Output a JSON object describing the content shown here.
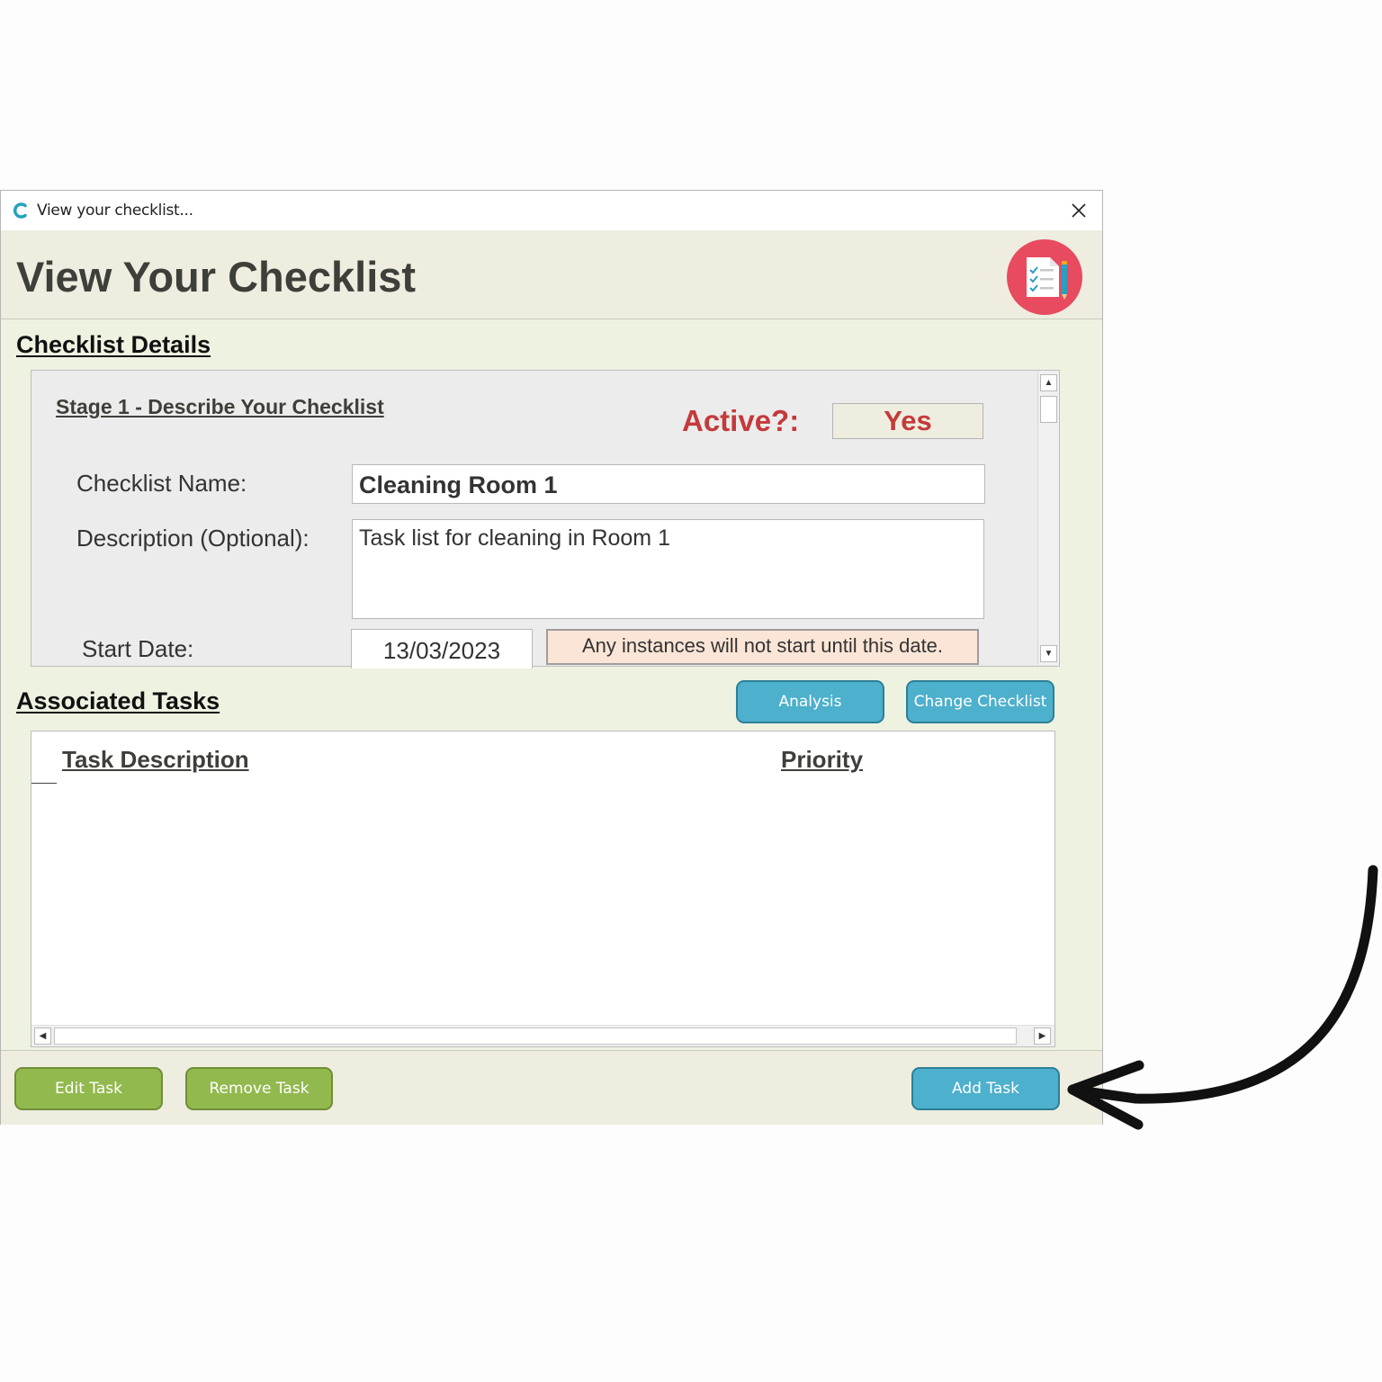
{
  "window": {
    "title": "View your checklist...",
    "close_icon": "close-icon"
  },
  "header": {
    "title": "View Your Checklist",
    "logo_icon": "checklist-clipboard-icon",
    "logo_color": "#e84a5f"
  },
  "details": {
    "section_title": "Checklist Details",
    "stage_title": "Stage 1 - Describe Your Checklist",
    "active_label": "Active?:",
    "active_value": "Yes",
    "name_label": "Checklist Name:",
    "name_value": "Cleaning Room 1",
    "description_label": "Description (Optional):",
    "description_value": "Task list for cleaning in Room 1",
    "start_date_label": "Start Date:",
    "start_date_value": "13/03/2023",
    "start_date_hint": "Any instances will not start until this date."
  },
  "tasks": {
    "section_title": "Associated Tasks",
    "analysis_label": "Analysis",
    "change_checklist_label": "Change Checklist",
    "columns": [
      "Task Description",
      "Priority"
    ],
    "rows": []
  },
  "footer": {
    "edit_label": "Edit Task",
    "remove_label": "Remove Task",
    "add_label": "Add Task"
  },
  "colors": {
    "accent_blue": "#4db0cc",
    "accent_green": "#92b94e",
    "active_red": "#c43a3a"
  }
}
